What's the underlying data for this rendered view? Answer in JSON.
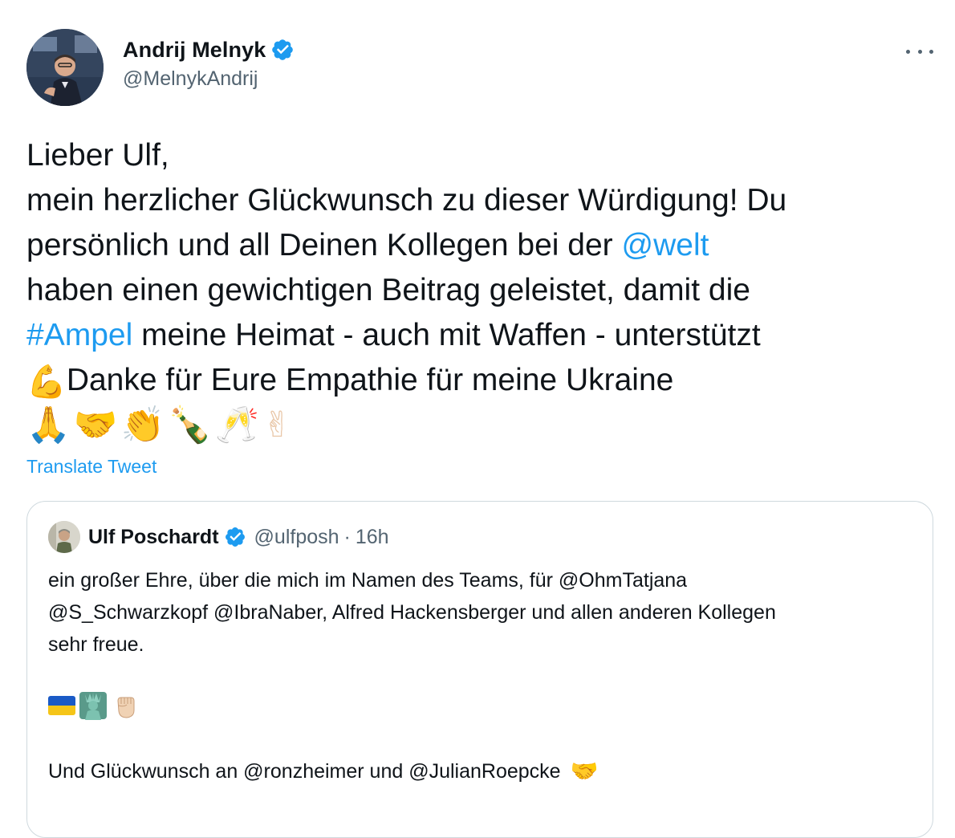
{
  "tweet": {
    "author": {
      "display_name": "Andrij Melnyk",
      "handle": "@MelnykAndrij",
      "verified_icon": "verified-badge-icon"
    },
    "more_icon": "more-options-icon",
    "body": {
      "line1": "Lieber Ulf,",
      "line2": "mein herzlicher Glückwunsch zu dieser Würdigung! Du",
      "line3_pre": "persönlich und all Deinen Kollegen bei der ",
      "line3_link": "@welt",
      "line4": "haben einen gewichtigen Beitrag geleistet, damit die",
      "line5_hashtag": "#Ampel",
      "line5_post": " meine Heimat - auch mit Waffen - unterstützt",
      "line6_emoji": "💪",
      "line6_text": "Danke für Eure Empathie für meine Ukraine"
    },
    "emoji_row": [
      "🙏",
      "🤝",
      "👏",
      "🍾",
      "🥂",
      "✌"
    ],
    "translate_label": "Translate Tweet",
    "colors": {
      "link": "#1d9bf0",
      "secondary_text": "#536471",
      "border": "#cfd9de"
    }
  },
  "quoted": {
    "display_name": "Ulf Poschardt",
    "handle": "@ulfposh",
    "separator": "·",
    "time": "16h",
    "text_line1": "ein großer Ehre, über die mich im Namen des Teams, für @OhmTatjana",
    "text_line2": "@S_Schwarzkopf @IbraNaber, Alfred Hackensberger und allen anderen Kollegen",
    "text_line3": "sehr freue.",
    "emoji_row": [
      "ukraine-flag-icon",
      "statue-of-liberty-icon",
      "raised-fist-icon"
    ],
    "text2": "Und Glückwunsch an @ronzheimer und @JulianRoepcke",
    "text2_emoji": "🤝"
  }
}
